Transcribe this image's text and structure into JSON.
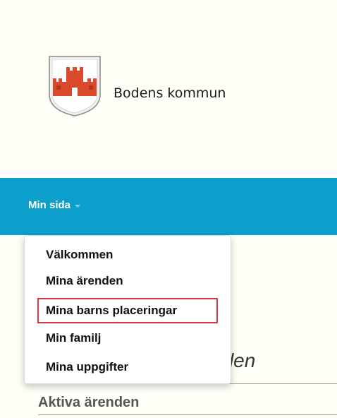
{
  "header": {
    "brand_name": "Bodens kommun",
    "logo_icon": "coat-of-arms-icon"
  },
  "nav": {
    "menu_label": "Min sida",
    "caret_icon": "chevron-down-icon",
    "bar_color": "#0d9fcb"
  },
  "dropdown": {
    "items": [
      {
        "label": "Välkommen"
      },
      {
        "label": "Mina ärenden"
      },
      {
        "label": "Mina barns placeringar"
      },
      {
        "label": "Min familj"
      },
      {
        "label": "Mina uppgifter"
      }
    ],
    "highlight_color": "#d9363e"
  },
  "main": {
    "page_heading_partial": "nden",
    "section_heading": "Aktiva ärenden"
  }
}
